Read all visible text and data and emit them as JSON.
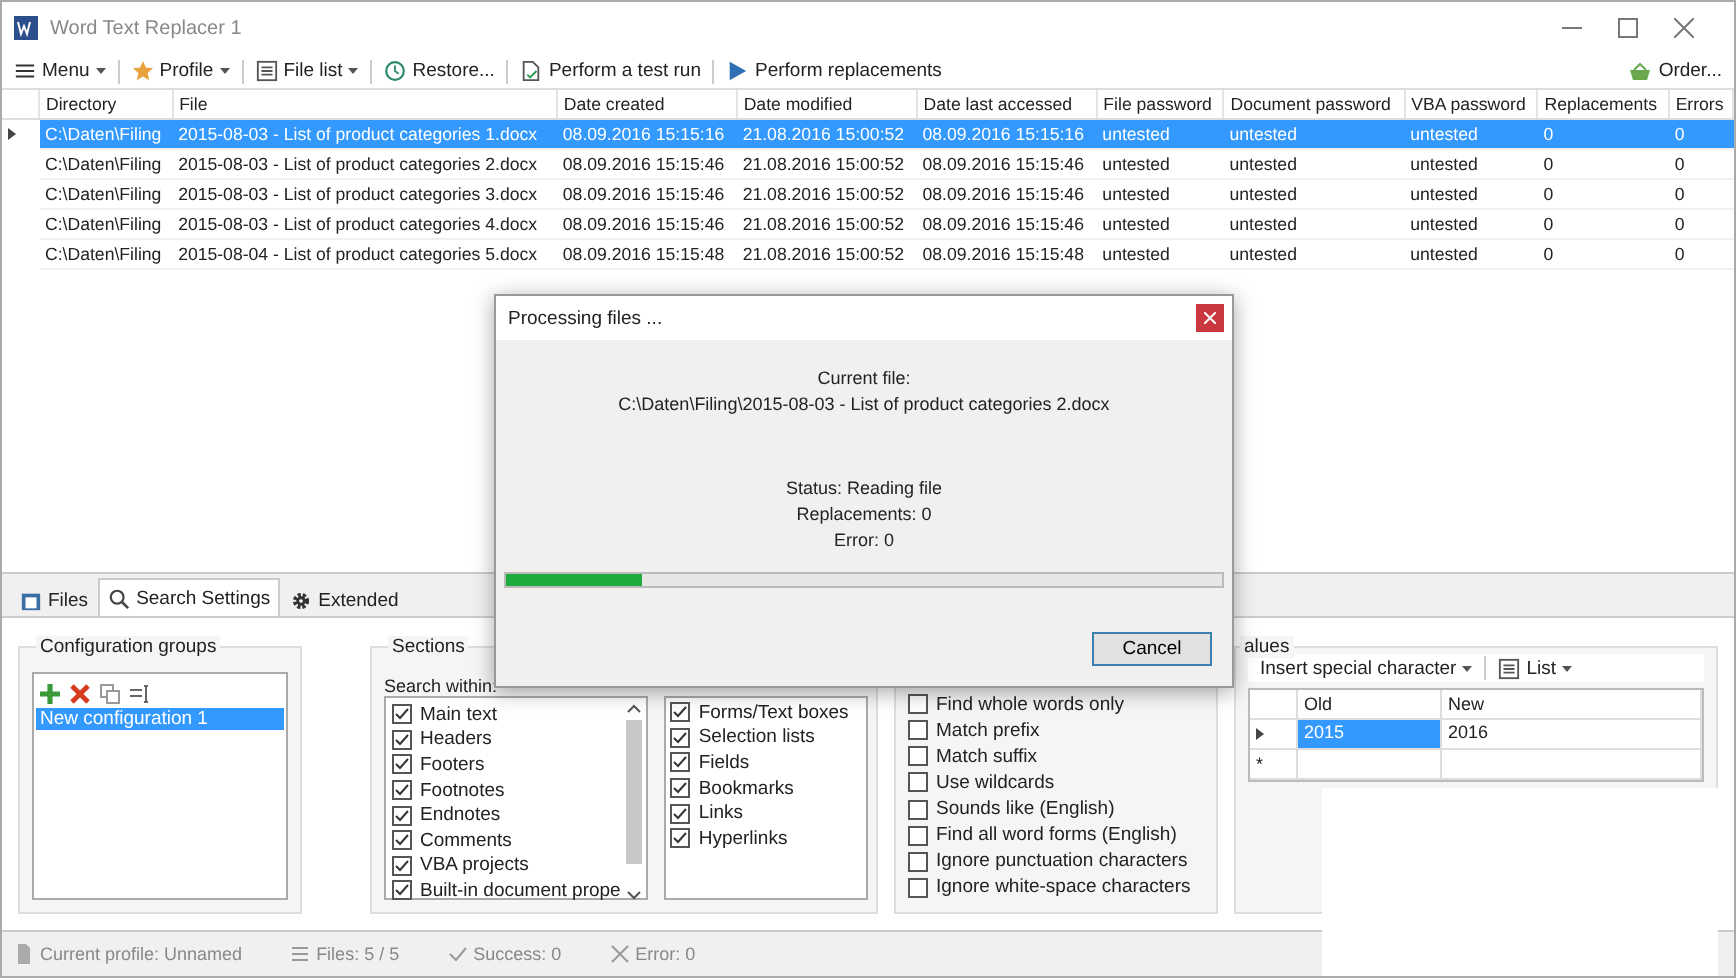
{
  "window": {
    "title": "Word Text Replacer 1"
  },
  "toolbar": {
    "items": [
      {
        "label": "Menu",
        "kind": "menu",
        "has_menu": true
      },
      {
        "label": "Profile",
        "kind": "star",
        "has_menu": true
      },
      {
        "label": "File list",
        "kind": "list",
        "has_menu": true
      },
      {
        "label": "Restore...",
        "kind": "clock",
        "has_menu": false
      },
      {
        "label": "Perform a test run",
        "kind": "test",
        "has_menu": false
      },
      {
        "label": "Perform replacements",
        "kind": "play",
        "has_menu": false
      }
    ],
    "order": "Order..."
  },
  "table": {
    "columns": [
      "Directory",
      "File",
      "Date created",
      "Date modified",
      "Date last accessed",
      "File password",
      "Document password",
      "VBA password",
      "Replacements",
      "Errors"
    ],
    "rows": [
      {
        "selected": true,
        "cells": [
          "C:\\Daten\\Filing",
          "2015-08-03 - List of product categories 1.docx",
          "08.09.2016 15:15:16",
          "21.08.2016 15:00:52",
          "08.09.2016 15:15:16",
          "untested",
          "untested",
          "untested",
          "0",
          "0"
        ]
      },
      {
        "selected": false,
        "cells": [
          "C:\\Daten\\Filing",
          "2015-08-03 - List of product categories 2.docx",
          "08.09.2016 15:15:46",
          "21.08.2016 15:00:52",
          "08.09.2016 15:15:46",
          "untested",
          "untested",
          "untested",
          "0",
          "0"
        ]
      },
      {
        "selected": false,
        "cells": [
          "C:\\Daten\\Filing",
          "2015-08-03 - List of product categories 3.docx",
          "08.09.2016 15:15:46",
          "21.08.2016 15:00:52",
          "08.09.2016 15:15:46",
          "untested",
          "untested",
          "untested",
          "0",
          "0"
        ]
      },
      {
        "selected": false,
        "cells": [
          "C:\\Daten\\Filing",
          "2015-08-03 - List of product categories 4.docx",
          "08.09.2016 15:15:46",
          "21.08.2016 15:00:52",
          "08.09.2016 15:15:46",
          "untested",
          "untested",
          "untested",
          "0",
          "0"
        ]
      },
      {
        "selected": false,
        "cells": [
          "C:\\Daten\\Filing",
          "2015-08-04 - List of product categories 5.docx",
          "08.09.2016 15:15:48",
          "21.08.2016 15:00:52",
          "08.09.2016 15:15:48",
          "untested",
          "untested",
          "untested",
          "0",
          "0"
        ]
      }
    ]
  },
  "tabs": [
    {
      "label": "Files",
      "kind": "files",
      "selected": false
    },
    {
      "label": "Search Settings",
      "kind": "search",
      "selected": true
    },
    {
      "label": "Extended",
      "kind": "gear",
      "selected": false
    }
  ],
  "config_groups": {
    "title": "Configuration groups",
    "items": [
      {
        "label": "New configuration 1",
        "selected": true
      }
    ]
  },
  "sections": {
    "title": "Sections",
    "search_within_label": "Search within:",
    "list_a": [
      {
        "label": "Main text",
        "checked": true
      },
      {
        "label": "Headers",
        "checked": true
      },
      {
        "label": "Footers",
        "checked": true
      },
      {
        "label": "Footnotes",
        "checked": true
      },
      {
        "label": "Endnotes",
        "checked": true
      },
      {
        "label": "Comments",
        "checked": true
      },
      {
        "label": "VBA projects",
        "checked": true
      },
      {
        "label": "Built-in document prope",
        "checked": true
      }
    ],
    "list_b": [
      {
        "label": "Forms/Text boxes",
        "checked": true
      },
      {
        "label": "Selection lists",
        "checked": true
      },
      {
        "label": "Fields",
        "checked": true
      },
      {
        "label": "Bookmarks",
        "checked": true
      },
      {
        "label": "Links",
        "checked": true
      },
      {
        "label": "Hyperlinks",
        "checked": true
      }
    ]
  },
  "options": [
    {
      "label": "Find whole words only",
      "checked": false
    },
    {
      "label": "Match prefix",
      "checked": false
    },
    {
      "label": "Match suffix",
      "checked": false
    },
    {
      "label": "Use wildcards",
      "checked": false
    },
    {
      "label": "Sounds like (English)",
      "checked": false
    },
    {
      "label": "Find all word forms (English)",
      "checked": false
    },
    {
      "label": "Ignore punctuation characters",
      "checked": false
    },
    {
      "label": "Ignore white-space characters",
      "checked": false
    }
  ],
  "values": {
    "title": "alues",
    "toolbar": [
      "Insert special character",
      "List"
    ],
    "columns": [
      "Old",
      "New"
    ],
    "rows": [
      {
        "selected": true,
        "cells": [
          "2015",
          "2016"
        ]
      }
    ],
    "new_row_marker": "*"
  },
  "status_bar": [
    {
      "kind": "doc",
      "label": "Current profile: Unnamed"
    },
    {
      "kind": "list",
      "label": "Files: 5 / 5"
    },
    {
      "kind": "check",
      "label": "Success: 0"
    },
    {
      "kind": "cross",
      "label": "Error: 0"
    }
  ],
  "dialog": {
    "title": "Processing files ...",
    "current_file_label": "Current file:",
    "current_file": "C:\\Daten\\Filing\\2015-08-03 - List of product categories 2.docx",
    "status": "Status: Reading file",
    "replacements": "Replacements: 0",
    "error": "Error: 0",
    "level": 0.19,
    "cancel": "Cancel"
  }
}
